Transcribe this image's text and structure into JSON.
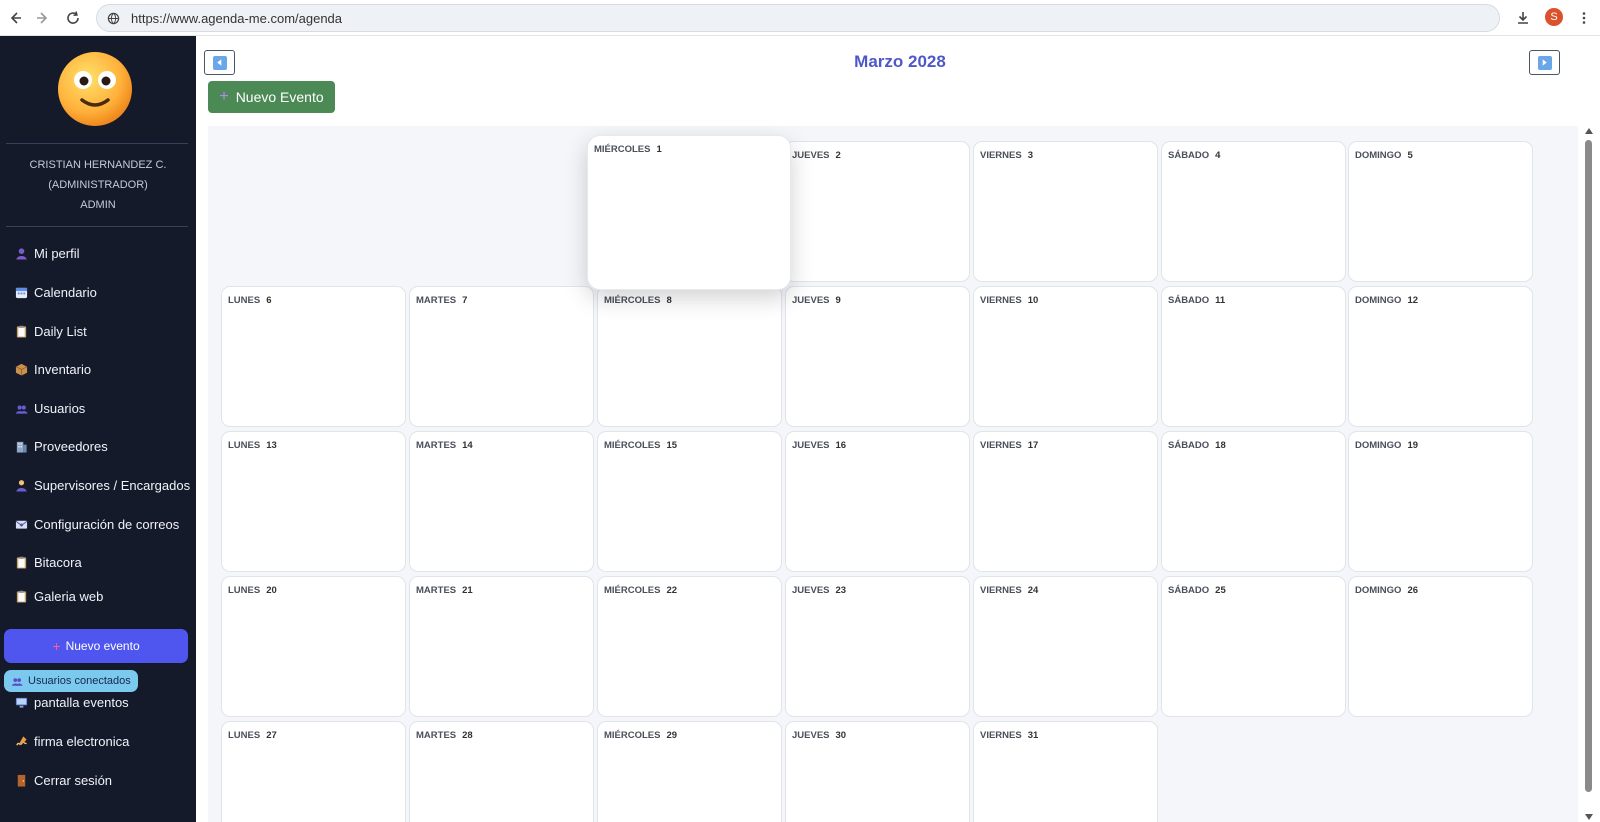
{
  "browser": {
    "url": "https://www.agenda-me.com/agenda",
    "profile_initial": "S"
  },
  "sidebar": {
    "user_name": "CRISTIAN HERNANDEZ C.",
    "user_role": "(ADMINISTRADOR)",
    "user_login": "ADMIN",
    "items": [
      {
        "label": "Mi perfil",
        "icon": "user-icon"
      },
      {
        "label": "Calendario",
        "icon": "calendar-icon"
      },
      {
        "label": "Daily List",
        "icon": "clipboard-icon"
      },
      {
        "label": "Inventario",
        "icon": "package-icon"
      },
      {
        "label": "Usuarios",
        "icon": "users-icon"
      },
      {
        "label": "Proveedores",
        "icon": "building-icon"
      },
      {
        "label": "Supervisores / Encargados",
        "icon": "supervisor-icon"
      },
      {
        "label": "Configuración de correos",
        "icon": "email-icon"
      },
      {
        "label": "Bitacora",
        "icon": "clipboard-icon"
      },
      {
        "label": "Galeria web",
        "icon": "clipboard-icon"
      }
    ],
    "new_event_button": "Nuevo evento",
    "connected_users": "Usuarios conectados",
    "items_bottom": [
      {
        "label": "pantalla eventos",
        "icon": "monitor-icon"
      },
      {
        "label": "firma electronica",
        "icon": "signature-icon"
      },
      {
        "label": "Cerrar sesión",
        "icon": "door-icon"
      }
    ]
  },
  "calendar": {
    "month_title": "Marzo 2028",
    "new_event_button": "Nuevo Evento",
    "weeks": [
      [
        null,
        null,
        {
          "day": "MIÉRCOLES",
          "num": "1"
        },
        {
          "day": "JUEVES",
          "num": "2"
        },
        {
          "day": "VIERNES",
          "num": "3"
        },
        {
          "day": "SÁBADO",
          "num": "4"
        },
        {
          "day": "DOMINGO",
          "num": "5"
        }
      ],
      [
        {
          "day": "LUNES",
          "num": "6"
        },
        {
          "day": "MARTES",
          "num": "7"
        },
        {
          "day": "MIÉRCOLES",
          "num": "8"
        },
        {
          "day": "JUEVES",
          "num": "9"
        },
        {
          "day": "VIERNES",
          "num": "10"
        },
        {
          "day": "SÁBADO",
          "num": "11"
        },
        {
          "day": "DOMINGO",
          "num": "12"
        }
      ],
      [
        {
          "day": "LUNES",
          "num": "13"
        },
        {
          "day": "MARTES",
          "num": "14"
        },
        {
          "day": "MIÉRCOLES",
          "num": "15"
        },
        {
          "day": "JUEVES",
          "num": "16"
        },
        {
          "day": "VIERNES",
          "num": "17"
        },
        {
          "day": "SÁBADO",
          "num": "18"
        },
        {
          "day": "DOMINGO",
          "num": "19"
        }
      ],
      [
        {
          "day": "LUNES",
          "num": "20"
        },
        {
          "day": "MARTES",
          "num": "21"
        },
        {
          "day": "MIÉRCOLES",
          "num": "22"
        },
        {
          "day": "JUEVES",
          "num": "23"
        },
        {
          "day": "VIERNES",
          "num": "24"
        },
        {
          "day": "SÁBADO",
          "num": "25"
        },
        {
          "day": "DOMINGO",
          "num": "26"
        }
      ],
      [
        {
          "day": "LUNES",
          "num": "27"
        },
        {
          "day": "MARTES",
          "num": "28"
        },
        {
          "day": "MIÉRCOLES",
          "num": "29"
        },
        {
          "day": "JUEVES",
          "num": "30"
        },
        {
          "day": "VIERNES",
          "num": "31"
        },
        null,
        null
      ]
    ],
    "lifted_day": "1"
  },
  "colors": {
    "sidebar_bg": "#151a2b",
    "accent_blue": "#4f56f0",
    "title_color": "#4e58c9",
    "new_event_green": "#4c8a55"
  }
}
